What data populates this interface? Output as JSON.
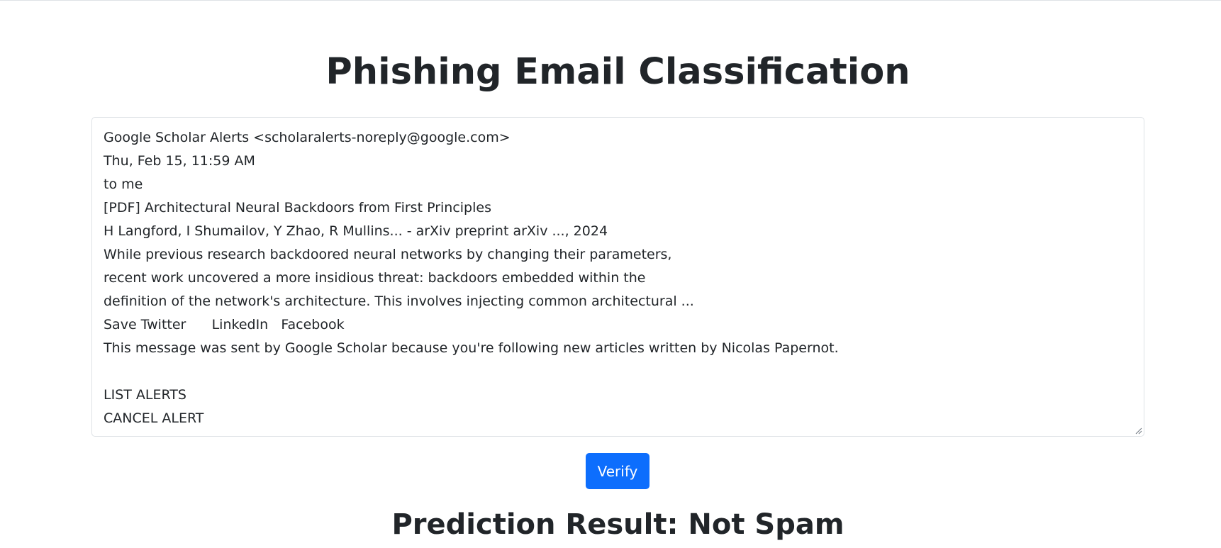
{
  "header": {
    "title": "Phishing Email Classification"
  },
  "email": {
    "content": "Google Scholar Alerts <scholaralerts-noreply@google.com>\nThu, Feb 15, 11:59 AM\nto me\n[PDF] Architectural Neural Backdoors from First Principles\nH Langford, I Shumailov, Y Zhao, R Mullins... - arXiv preprint arXiv ..., 2024\nWhile previous research backdoored neural networks by changing their parameters,\nrecent work uncovered a more insidious threat: backdoors embedded within the\ndefinition of the network's architecture. This involves injecting common architectural ...\nSave Twitter      LinkedIn   Facebook\nThis message was sent by Google Scholar because you're following new articles written by Nicolas Papernot.\n\nLIST ALERTS\nCANCEL ALERT"
  },
  "actions": {
    "verify_label": "Verify"
  },
  "result": {
    "text": "Prediction Result: Not Spam"
  },
  "colors": {
    "primary_button": "#0d6efd",
    "text": "#212529",
    "border": "#dee2e6"
  },
  "icons": {
    "resize": "resize-grip-icon"
  }
}
